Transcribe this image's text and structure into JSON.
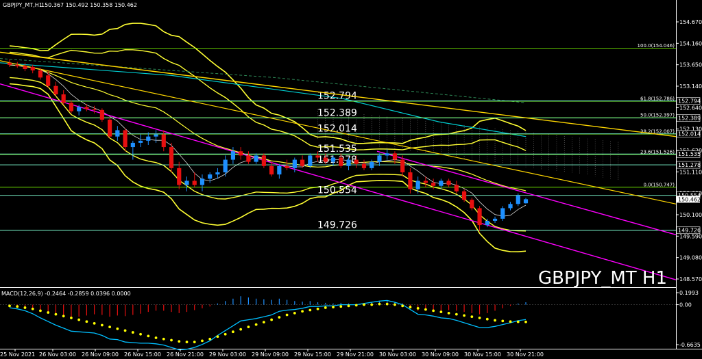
{
  "header": {
    "symbol": "GBPJPY_MT,H1",
    "ohlc": "150.367 150.492 150.358 150.462"
  },
  "watermark": "GBPJPY_MT H1",
  "macd": {
    "label": "MACD(12,26,9) -0.2464 -0.2859 0.0396 0.0000",
    "ticks": [
      "0.1993",
      "0.00",
      "-0.6635"
    ]
  },
  "price_axis": {
    "ticks": [
      "154.670",
      "154.160",
      "153.650",
      "153.140",
      "152.640",
      "152.130",
      "151.620",
      "151.110",
      "150.600",
      "150.100",
      "149.590",
      "149.080",
      "148.570"
    ],
    "current_price": "150.462"
  },
  "time_axis": {
    "labels": [
      "25 Nov 2021",
      "26 Nov 03:00",
      "26 Nov 09:00",
      "26 Nov 15:00",
      "26 Nov 21:00",
      "29 Nov 03:00",
      "29 Nov 09:00",
      "29 Nov 15:00",
      "29 Nov 21:00",
      "30 Nov 03:00",
      "30 Nov 09:00",
      "30 Nov 15:00",
      "30 Nov 21:00"
    ]
  },
  "levels": [
    {
      "value": 152.794,
      "label": "152.794",
      "tag": "152.794"
    },
    {
      "value": 152.389,
      "label": "152.389",
      "tag": "152.389"
    },
    {
      "value": 152.014,
      "label": "152.014",
      "tag": "152.014"
    },
    {
      "value": 151.535,
      "label": "151.535",
      "tag": "151.535"
    },
    {
      "value": 151.278,
      "label": "151.278",
      "tag": "151.278"
    },
    {
      "value": 150.554,
      "label": "150.554",
      "tag": "150.554"
    },
    {
      "value": 149.726,
      "label": "149.726",
      "tag": "149.726"
    }
  ],
  "fibonacci": [
    {
      "value": 154.046,
      "label": "100.0(154.046)"
    },
    {
      "value": 152.786,
      "label": "61.8(152.786)"
    },
    {
      "value": 152.397,
      "label": "50.0(152.397)"
    },
    {
      "value": 152.007,
      "label": "38.2(152.007)"
    },
    {
      "value": 151.526,
      "label": "23.6(151.526)"
    },
    {
      "value": 150.747,
      "label": "0.0(150.747)"
    }
  ],
  "colors": {
    "up": "#1e90ff",
    "down": "#e81010",
    "level_line": "#7fffd4",
    "fib_line": "#7cfc00",
    "trend_yellow": "#ffd700",
    "trend_magenta": "#ff00ff",
    "cyan_ma": "#00ced1",
    "bollinger": "#ffff33",
    "macd_signal": "#ffff00",
    "macd_line": "#00bfff"
  },
  "chart_data": {
    "type": "candlestick",
    "symbol": "GBPJPY_MT",
    "timeframe": "H1",
    "ylim": [
      148.3,
      155.0
    ],
    "candles": [
      {
        "o": 153.7,
        "h": 153.78,
        "l": 153.6,
        "c": 153.65
      },
      {
        "o": 153.65,
        "h": 153.72,
        "l": 153.58,
        "c": 153.62
      },
      {
        "o": 153.62,
        "h": 153.7,
        "l": 153.5,
        "c": 153.55
      },
      {
        "o": 153.6,
        "h": 153.65,
        "l": 153.45,
        "c": 153.52
      },
      {
        "o": 153.52,
        "h": 153.58,
        "l": 153.3,
        "c": 153.35
      },
      {
        "o": 153.4,
        "h": 153.5,
        "l": 153.1,
        "c": 153.15
      },
      {
        "o": 153.15,
        "h": 153.25,
        "l": 152.9,
        "c": 152.95
      },
      {
        "o": 152.95,
        "h": 153.05,
        "l": 152.7,
        "c": 152.75
      },
      {
        "o": 152.75,
        "h": 152.8,
        "l": 152.5,
        "c": 152.55
      },
      {
        "o": 152.55,
        "h": 152.7,
        "l": 152.45,
        "c": 152.65
      },
      {
        "o": 152.65,
        "h": 152.72,
        "l": 152.55,
        "c": 152.6
      },
      {
        "o": 152.6,
        "h": 152.68,
        "l": 152.5,
        "c": 152.58
      },
      {
        "o": 152.58,
        "h": 152.62,
        "l": 152.3,
        "c": 152.35
      },
      {
        "o": 152.35,
        "h": 152.4,
        "l": 151.9,
        "c": 151.95
      },
      {
        "o": 151.95,
        "h": 152.2,
        "l": 151.85,
        "c": 152.1
      },
      {
        "o": 152.1,
        "h": 152.15,
        "l": 151.6,
        "c": 151.7
      },
      {
        "o": 151.7,
        "h": 151.85,
        "l": 151.4,
        "c": 151.8
      },
      {
        "o": 151.8,
        "h": 152.0,
        "l": 151.7,
        "c": 151.85
      },
      {
        "o": 151.85,
        "h": 152.05,
        "l": 151.75,
        "c": 151.95
      },
      {
        "o": 151.95,
        "h": 152.1,
        "l": 151.8,
        "c": 152.0
      },
      {
        "o": 152.0,
        "h": 152.1,
        "l": 151.6,
        "c": 151.7
      },
      {
        "o": 151.7,
        "h": 151.8,
        "l": 151.1,
        "c": 151.2
      },
      {
        "o": 151.2,
        "h": 151.35,
        "l": 150.7,
        "c": 150.8
      },
      {
        "o": 150.8,
        "h": 151.0,
        "l": 150.65,
        "c": 150.9
      },
      {
        "o": 150.9,
        "h": 151.1,
        "l": 150.75,
        "c": 150.8
      },
      {
        "o": 150.8,
        "h": 151.05,
        "l": 150.65,
        "c": 150.95
      },
      {
        "o": 150.95,
        "h": 151.1,
        "l": 150.85,
        "c": 151.05
      },
      {
        "o": 151.05,
        "h": 151.2,
        "l": 150.95,
        "c": 151.1
      },
      {
        "o": 151.1,
        "h": 151.5,
        "l": 151.0,
        "c": 151.4
      },
      {
        "o": 151.4,
        "h": 151.7,
        "l": 151.3,
        "c": 151.6
      },
      {
        "o": 151.6,
        "h": 151.7,
        "l": 151.4,
        "c": 151.5
      },
      {
        "o": 151.5,
        "h": 151.6,
        "l": 151.3,
        "c": 151.35
      },
      {
        "o": 151.35,
        "h": 151.55,
        "l": 151.3,
        "c": 151.5
      },
      {
        "o": 151.5,
        "h": 151.55,
        "l": 151.2,
        "c": 151.25
      },
      {
        "o": 151.25,
        "h": 151.35,
        "l": 151.0,
        "c": 151.05
      },
      {
        "o": 151.05,
        "h": 151.3,
        "l": 150.95,
        "c": 151.25
      },
      {
        "o": 151.25,
        "h": 151.4,
        "l": 151.15,
        "c": 151.2
      },
      {
        "o": 151.2,
        "h": 151.45,
        "l": 151.1,
        "c": 151.4
      },
      {
        "o": 151.4,
        "h": 151.5,
        "l": 151.2,
        "c": 151.25
      },
      {
        "o": 151.25,
        "h": 151.55,
        "l": 151.2,
        "c": 151.5
      },
      {
        "o": 151.5,
        "h": 151.6,
        "l": 151.35,
        "c": 151.45
      },
      {
        "o": 151.45,
        "h": 151.55,
        "l": 151.3,
        "c": 151.35
      },
      {
        "o": 151.35,
        "h": 151.5,
        "l": 151.25,
        "c": 151.45
      },
      {
        "o": 151.45,
        "h": 151.55,
        "l": 151.2,
        "c": 151.25
      },
      {
        "o": 151.25,
        "h": 151.45,
        "l": 151.15,
        "c": 151.4
      },
      {
        "o": 151.4,
        "h": 151.5,
        "l": 151.2,
        "c": 151.3
      },
      {
        "o": 151.3,
        "h": 151.4,
        "l": 151.15,
        "c": 151.2
      },
      {
        "o": 151.2,
        "h": 151.4,
        "l": 151.15,
        "c": 151.35
      },
      {
        "o": 151.35,
        "h": 151.55,
        "l": 151.25,
        "c": 151.5
      },
      {
        "o": 151.5,
        "h": 151.65,
        "l": 151.4,
        "c": 151.55
      },
      {
        "o": 151.55,
        "h": 151.6,
        "l": 151.3,
        "c": 151.4
      },
      {
        "o": 151.4,
        "h": 151.5,
        "l": 151.0,
        "c": 151.1
      },
      {
        "o": 151.1,
        "h": 151.2,
        "l": 150.6,
        "c": 150.7
      },
      {
        "o": 150.7,
        "h": 151.0,
        "l": 150.6,
        "c": 150.9
      },
      {
        "o": 150.9,
        "h": 151.0,
        "l": 150.75,
        "c": 150.85
      },
      {
        "o": 150.85,
        "h": 150.95,
        "l": 150.7,
        "c": 150.78
      },
      {
        "o": 150.78,
        "h": 150.95,
        "l": 150.7,
        "c": 150.9
      },
      {
        "o": 150.9,
        "h": 150.95,
        "l": 150.75,
        "c": 150.8
      },
      {
        "o": 150.8,
        "h": 150.9,
        "l": 150.6,
        "c": 150.65
      },
      {
        "o": 150.65,
        "h": 150.7,
        "l": 150.4,
        "c": 150.45
      },
      {
        "o": 150.45,
        "h": 150.5,
        "l": 150.2,
        "c": 150.25
      },
      {
        "o": 150.25,
        "h": 150.3,
        "l": 149.7,
        "c": 149.85
      },
      {
        "o": 149.85,
        "h": 150.0,
        "l": 149.8,
        "c": 149.95
      },
      {
        "o": 149.95,
        "h": 150.05,
        "l": 149.9,
        "c": 150.0
      },
      {
        "o": 150.0,
        "h": 150.3,
        "l": 149.95,
        "c": 150.25
      },
      {
        "o": 150.25,
        "h": 150.4,
        "l": 150.2,
        "c": 150.35
      },
      {
        "o": 150.35,
        "h": 150.6,
        "l": 150.3,
        "c": 150.55
      },
      {
        "o": 150.367,
        "h": 150.492,
        "l": 150.358,
        "c": 150.462
      }
    ],
    "macd": {
      "histogram": [
        -0.02,
        -0.03,
        -0.05,
        -0.08,
        -0.12,
        -0.15,
        -0.18,
        -0.2,
        -0.22,
        -0.2,
        -0.18,
        -0.16,
        -0.17,
        -0.2,
        -0.18,
        -0.19,
        -0.17,
        -0.15,
        -0.12,
        -0.1,
        -0.1,
        -0.12,
        -0.14,
        -0.12,
        -0.09,
        -0.06,
        -0.03,
        0.02,
        0.06,
        0.1,
        0.14,
        0.12,
        0.1,
        0.09,
        0.08,
        0.1,
        0.08,
        0.06,
        0.05,
        0.06,
        0.04,
        0.03,
        0.02,
        0.03,
        0.02,
        0.01,
        0.02,
        0.04,
        0.05,
        0.06,
        0.04,
        0.02,
        -0.04,
        -0.1,
        -0.09,
        -0.09,
        -0.1,
        -0.09,
        -0.1,
        -0.12,
        -0.14,
        -0.16,
        -0.14,
        -0.1,
        -0.06,
        -0.02,
        0.02,
        0.04
      ],
      "signal": [
        -0.02,
        -0.03,
        -0.05,
        -0.07,
        -0.1,
        -0.13,
        -0.16,
        -0.19,
        -0.22,
        -0.25,
        -0.28,
        -0.31,
        -0.34,
        -0.37,
        -0.4,
        -0.43,
        -0.46,
        -0.49,
        -0.52,
        -0.55,
        -0.57,
        -0.59,
        -0.61,
        -0.62,
        -0.62,
        -0.6,
        -0.57,
        -0.53,
        -0.49,
        -0.45,
        -0.41,
        -0.37,
        -0.33,
        -0.29,
        -0.25,
        -0.21,
        -0.17,
        -0.14,
        -0.11,
        -0.09,
        -0.07,
        -0.05,
        -0.04,
        -0.03,
        -0.02,
        -0.01,
        0.0,
        0.0,
        0.01,
        0.01,
        0.0,
        -0.02,
        -0.04,
        -0.06,
        -0.08,
        -0.1,
        -0.12,
        -0.14,
        -0.16,
        -0.18,
        -0.2,
        -0.22,
        -0.24,
        -0.26,
        -0.27,
        -0.28,
        -0.285,
        -0.2859
      ],
      "line": [
        -0.05,
        -0.07,
        -0.1,
        -0.15,
        -0.22,
        -0.28,
        -0.34,
        -0.39,
        -0.44,
        -0.45,
        -0.46,
        -0.47,
        -0.51,
        -0.57,
        -0.58,
        -0.62,
        -0.63,
        -0.64,
        -0.64,
        -0.65,
        -0.67,
        -0.71,
        -0.75,
        -0.74,
        -0.71,
        -0.66,
        -0.6,
        -0.51,
        -0.43,
        -0.35,
        -0.27,
        -0.25,
        -0.23,
        -0.2,
        -0.17,
        -0.11,
        -0.09,
        -0.08,
        -0.06,
        -0.03,
        -0.03,
        -0.02,
        -0.02,
        0.0,
        0.0,
        0.0,
        0.02,
        0.04,
        0.06,
        0.07,
        0.04,
        0.0,
        -0.08,
        -0.16,
        -0.17,
        -0.19,
        -0.22,
        -0.23,
        -0.26,
        -0.3,
        -0.34,
        -0.38,
        -0.38,
        -0.36,
        -0.33,
        -0.3,
        -0.265,
        -0.2464
      ]
    }
  }
}
